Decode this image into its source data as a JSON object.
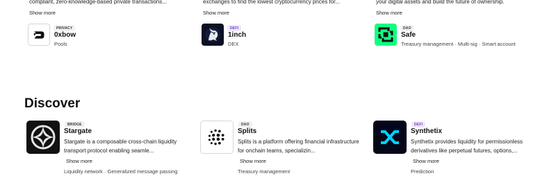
{
  "top_cards": [
    {
      "description": "compliant, zero-knowledge-based private transactions...",
      "show_more": "Show more",
      "badge": "PRIVACY",
      "name": "0xbow",
      "tags": "Pools",
      "logo_icon": "0xbow-logo-icon"
    },
    {
      "description": "exchanges to find the lowest cryptocurrency prices for...",
      "show_more": "Show more",
      "badge": "DEFI",
      "name": "1inch",
      "tags": "DEX",
      "logo_icon": "1inch-unicorn-logo-icon"
    },
    {
      "description": "your digital assets and build the future of ownership.",
      "show_more": "Show more",
      "badge": "DAO",
      "name": "Safe",
      "tags": "Treasury management · Multi-sig · Smart account",
      "logo_icon": "safe-logo-icon"
    }
  ],
  "discover": {
    "title": "Discover",
    "cards": [
      {
        "badge": "BRIDGE",
        "name": "Stargate",
        "description": "Stargate is a composable cross-chain liquidity transport protocol enabling seamle...",
        "show_more": "Show more",
        "tags": "Liquidity network · Generalized message passing",
        "logo_icon": "stargate-logo-icon"
      },
      {
        "badge": "DAO",
        "name": "Splits",
        "description": "Splits is a platform offering financial infrastructure for onchain teams, specializin...",
        "show_more": "Show more",
        "tags": "Treasury management",
        "logo_icon": "splits-logo-icon"
      },
      {
        "badge": "DEFI",
        "name": "Synthetix",
        "description": "Synthetix provides liquidity for permissionless derivatives like perpetual futures, options,...",
        "show_more": "Show more",
        "tags": "Prediction",
        "logo_icon": "synthetix-logo-icon"
      }
    ]
  },
  "colors": {
    "defi_badge_text": "#6b3fc2",
    "defi_badge_bg": "#efe7fb",
    "neutral_badge_bg": "#f1f1f3",
    "safe_green": "#12ff80",
    "synthetix_cyan": "#00d1ff"
  }
}
